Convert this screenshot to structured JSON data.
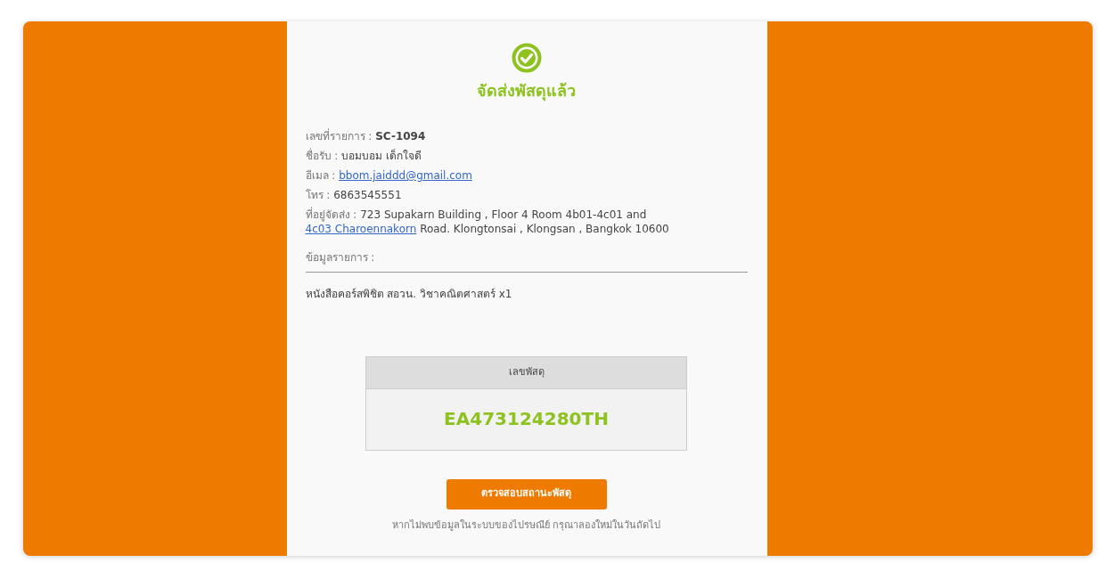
{
  "status": {
    "title": "จัดส่งพัสดุแล้ว"
  },
  "order": {
    "number_label": "เลขที่รายการ :",
    "number": "SC-1094",
    "name_label": "ชื่อรับ :",
    "name": "บอมบอม เด็กใจดี",
    "email_label": "อีเมล :",
    "email": "bbom.jaiddd@gmail.com",
    "phone_label": "โทร :",
    "phone": "6863545551",
    "address_label": "ที่อยู่จัดส่ง :",
    "address_before": "723 Supakarn Building , Floor 4 Room 4b01-4c01 and",
    "address_link": "4c03 Charoennakorn",
    "address_after": "Road. Klongtonsai , Klongsan , Bangkok 10600"
  },
  "items_label": "ข้อมูลรายการ :",
  "items": [
    "หนังสือคอร์สพิชิต สอวน. วิชาคณิตศาสตร์ x1"
  ],
  "tracking": {
    "header": "เลขพัสดุ",
    "number": "EA473124280TH"
  },
  "check_button": "ตรวจสอบสถานะพัสดุ",
  "note": "หากไม่พบข้อมูลในระบบของไปรษณีย์ กรุณาลองใหม่ในวันถัดไป"
}
